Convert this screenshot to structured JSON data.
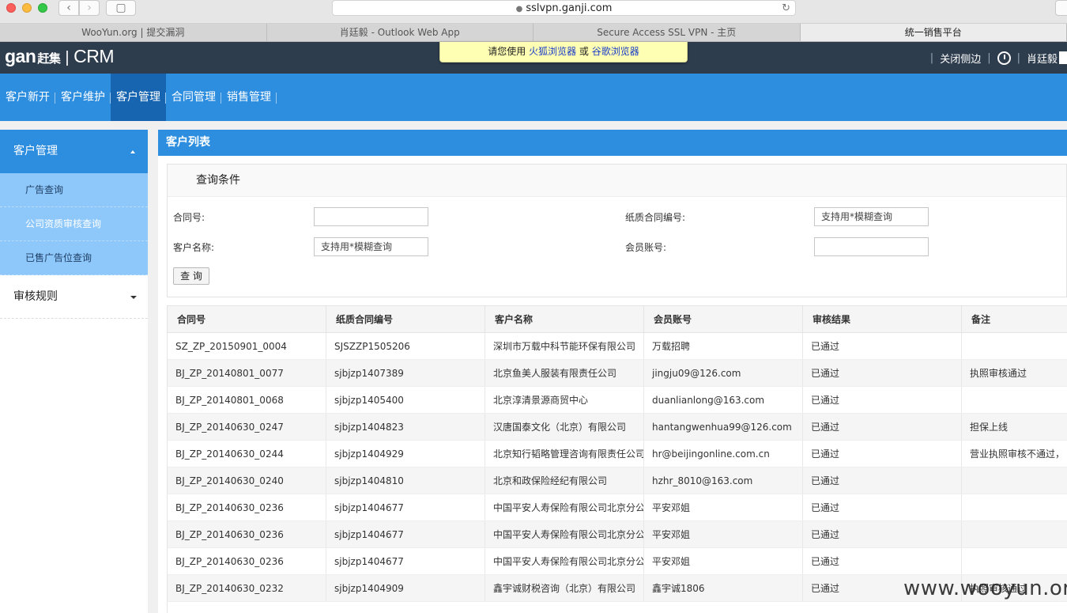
{
  "browser": {
    "url": "sslvpn.ganji.com",
    "tabs": [
      "WooYun.org | 提交漏洞",
      "肖廷毅 - Outlook Web App",
      "Secure Access SSL VPN - 主页",
      "统一销售平台"
    ]
  },
  "header": {
    "logo_brand": "gan",
    "logo_cn": "赶集",
    "logo_sep": "|",
    "logo_product": "CRM",
    "notice_prefix": "请您使用",
    "notice_link1": "火狐浏览器",
    "notice_or": "或",
    "notice_link2": "谷歌浏览器",
    "close_sidebar": "关闭侧边",
    "user_name": "肖廷毅"
  },
  "topnav": [
    "客户新开",
    "客户维护",
    "客户管理",
    "合同管理",
    "销售管理"
  ],
  "sidebar": {
    "group1": "客户管理",
    "subitems": [
      "广告查询",
      "公司资质审核查询",
      "已售广告位查询"
    ],
    "group2": "审核规则"
  },
  "main": {
    "title": "客户列表",
    "query_title": "查询条件",
    "labels": {
      "contract_no": "合同号:",
      "paper_contract_no": "纸质合同编号:",
      "customer_name": "客户名称:",
      "member_account": "会员账号:"
    },
    "placeholders": {
      "paper_contract_no": "支持用*模糊查询",
      "customer_name": "支持用*模糊查询"
    },
    "query_button": "查 询",
    "columns": [
      "合同号",
      "纸质合同编号",
      "客户名称",
      "会员账号",
      "审核结果",
      "备注"
    ],
    "rows": [
      [
        "SZ_ZP_20150901_0004",
        "SJSZZP1505206",
        "深圳市万载中科节能环保有限公司",
        "万载招聘",
        "已通过",
        ""
      ],
      [
        "BJ_ZP_20140801_0077",
        "sjbjzp1407389",
        "北京鱼美人服装有限责任公司",
        "jingju09@126.com",
        "已通过",
        "执照审核通过"
      ],
      [
        "BJ_ZP_20140801_0068",
        "sjbjzp1405400",
        "北京淳清景源商贸中心",
        "duanlianlong@163.com",
        "已通过",
        ""
      ],
      [
        "BJ_ZP_20140630_0247",
        "sjbjzp1404823",
        "汉唐国泰文化（北京）有限公司",
        "hantangwenhua99@126.com",
        "已通过",
        "担保上线"
      ],
      [
        "BJ_ZP_20140630_0244",
        "sjbjzp1404929",
        "北京知行韬略管理咨询有限责任公司",
        "hr@beijingonline.com.cn",
        "已通过",
        "营业执照审核不通过，"
      ],
      [
        "BJ_ZP_20140630_0240",
        "sjbjzp1404810",
        "北京和政保险经纪有限公司",
        "hzhr_8010@163.com",
        "已通过",
        ""
      ],
      [
        "BJ_ZP_20140630_0236",
        "sjbjzp1404677",
        "中国平安人寿保险有限公司北京分公",
        "平安邓姐",
        "已通过",
        ""
      ],
      [
        "BJ_ZP_20140630_0236",
        "sjbjzp1404677",
        "中国平安人寿保险有限公司北京分公",
        "平安邓姐",
        "已通过",
        ""
      ],
      [
        "BJ_ZP_20140630_0236",
        "sjbjzp1404677",
        "中国平安人寿保险有限公司北京分公",
        "平安邓姐",
        "已通过",
        ""
      ],
      [
        "BJ_ZP_20140630_0232",
        "sjbjzp1404909",
        "鑫宇诚财税咨询（北京）有限公司",
        "鑫宇诚1806",
        "已通过",
        "执照审核通过"
      ]
    ]
  },
  "watermark": "www.wooyun.org"
}
